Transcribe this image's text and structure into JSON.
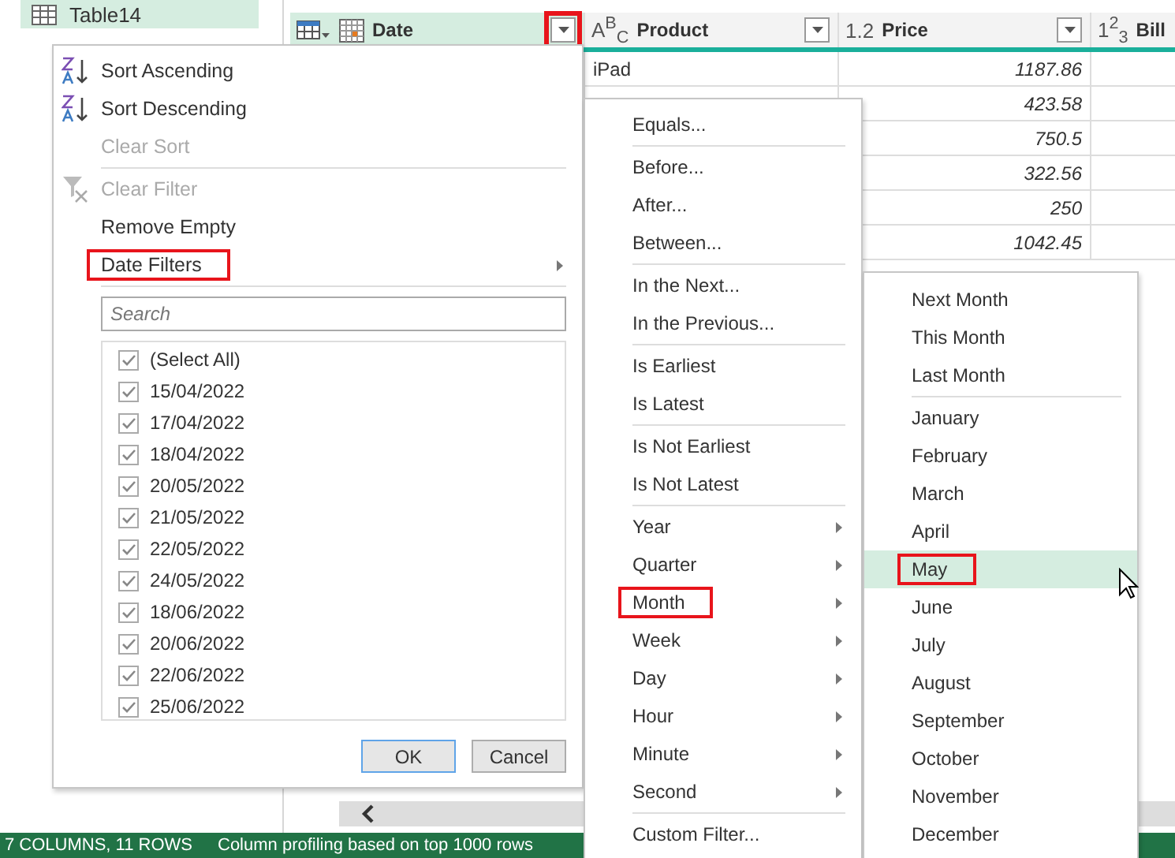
{
  "queries": [
    {
      "label": "Table14",
      "selected": true
    }
  ],
  "table": {
    "columns": [
      {
        "label": "Date",
        "kind": "date",
        "selected": true,
        "filter_button": true,
        "highlighted": true
      },
      {
        "label": "Product",
        "kind": "text",
        "type_label": "A$^{B}$$_{C}$",
        "selected": false,
        "filter_button": true,
        "highlighted": false
      },
      {
        "label": "Price",
        "kind": "decimal",
        "type_label": "1.2",
        "selected": false,
        "filter_button": true,
        "highlighted": false
      },
      {
        "label": "Bill",
        "kind": "whole",
        "type_label": "1$^{2}$$_{3}$",
        "selected": false
      }
    ],
    "rows": [
      {
        "product": "iPad",
        "price": "1187.86"
      },
      {
        "price": "423.58"
      },
      {
        "price": "750.5"
      },
      {
        "price": "322.56"
      },
      {
        "price": "250"
      },
      {
        "price": "1042.45"
      }
    ]
  },
  "filter_menu": {
    "groups": [
      [
        {
          "label": "Sort Ascending",
          "kind": "sort-asc",
          "disabled": false,
          "submenu": false,
          "highlighted": false
        },
        {
          "label": "Sort Descending",
          "kind": "sort-desc",
          "disabled": false,
          "submenu": false,
          "highlighted": false
        },
        {
          "label": "Clear Sort",
          "kind": "plain",
          "disabled": true,
          "submenu": false,
          "highlighted": false
        }
      ],
      [
        {
          "label": "Clear Filter",
          "kind": "clear-filter",
          "disabled": true,
          "submenu": false,
          "highlighted": false
        },
        {
          "label": "Remove Empty",
          "kind": "plain",
          "disabled": false,
          "submenu": false,
          "highlighted": false
        },
        {
          "label": "Date Filters",
          "kind": "plain",
          "disabled": false,
          "submenu": true,
          "highlighted": true
        }
      ]
    ],
    "search": {
      "placeholder": "Search"
    },
    "values": [
      {
        "label": "(Select All)",
        "checked": true
      },
      {
        "label": "15/04/2022",
        "checked": true
      },
      {
        "label": "17/04/2022",
        "checked": true
      },
      {
        "label": "18/04/2022",
        "checked": true
      },
      {
        "label": "20/05/2022",
        "checked": true
      },
      {
        "label": "21/05/2022",
        "checked": true
      },
      {
        "label": "22/05/2022",
        "checked": true
      },
      {
        "label": "24/05/2022",
        "checked": true
      },
      {
        "label": "18/06/2022",
        "checked": true
      },
      {
        "label": "20/06/2022",
        "checked": true
      },
      {
        "label": "22/06/2022",
        "checked": true
      },
      {
        "label": "25/06/2022",
        "checked": true
      }
    ],
    "buttons": [
      "OK",
      "Cancel"
    ]
  },
  "date_filters_menu": {
    "groups": [
      [
        {
          "label": "Equals...",
          "submenu": false,
          "highlighted": false
        }
      ],
      [
        {
          "label": "Before...",
          "submenu": false,
          "highlighted": false
        },
        {
          "label": "After...",
          "submenu": false,
          "highlighted": false
        },
        {
          "label": "Between...",
          "submenu": false,
          "highlighted": false
        }
      ],
      [
        {
          "label": "In the Next...",
          "submenu": false,
          "highlighted": false
        },
        {
          "label": "In the Previous...",
          "submenu": false,
          "highlighted": false
        }
      ],
      [
        {
          "label": "Is Earliest",
          "submenu": false,
          "highlighted": false
        },
        {
          "label": "Is Latest",
          "submenu": false,
          "highlighted": false
        }
      ],
      [
        {
          "label": "Is Not Earliest",
          "submenu": false,
          "highlighted": false
        },
        {
          "label": "Is Not Latest",
          "submenu": false,
          "highlighted": false
        }
      ],
      [
        {
          "label": "Year",
          "submenu": true,
          "highlighted": false
        },
        {
          "label": "Quarter",
          "submenu": true,
          "highlighted": false
        },
        {
          "label": "Month",
          "submenu": true,
          "highlighted": true
        },
        {
          "label": "Week",
          "submenu": true,
          "highlighted": false
        },
        {
          "label": "Day",
          "submenu": true,
          "highlighted": false
        },
        {
          "label": "Hour",
          "submenu": true,
          "highlighted": false
        },
        {
          "label": "Minute",
          "submenu": true,
          "highlighted": false
        },
        {
          "label": "Second",
          "submenu": true,
          "highlighted": false
        }
      ],
      [
        {
          "label": "Custom Filter...",
          "submenu": false,
          "highlighted": false
        }
      ]
    ]
  },
  "month_menu": {
    "groups": [
      [
        {
          "label": "Next Month",
          "selected": false,
          "highlighted": false
        },
        {
          "label": "This Month",
          "selected": false,
          "highlighted": false
        },
        {
          "label": "Last Month",
          "selected": false,
          "highlighted": false
        }
      ],
      [
        {
          "label": "January",
          "selected": false,
          "highlighted": false
        },
        {
          "label": "February",
          "selected": false,
          "highlighted": false
        },
        {
          "label": "March",
          "selected": false,
          "highlighted": false
        },
        {
          "label": "April",
          "selected": false,
          "highlighted": false
        },
        {
          "label": "May",
          "selected": true,
          "highlighted": true
        },
        {
          "label": "June",
          "selected": false,
          "highlighted": false
        },
        {
          "label": "July",
          "selected": false,
          "highlighted": false
        },
        {
          "label": "August",
          "selected": false,
          "highlighted": false
        },
        {
          "label": "September",
          "selected": false,
          "highlighted": false
        },
        {
          "label": "October",
          "selected": false,
          "highlighted": false
        },
        {
          "label": "November",
          "selected": false,
          "highlighted": false
        },
        {
          "label": "December",
          "selected": false,
          "highlighted": false
        }
      ]
    ]
  },
  "status_bar": {
    "counts": "7 COLUMNS, 11 ROWS",
    "profiling": "Column profiling based on top 1000 rows"
  }
}
